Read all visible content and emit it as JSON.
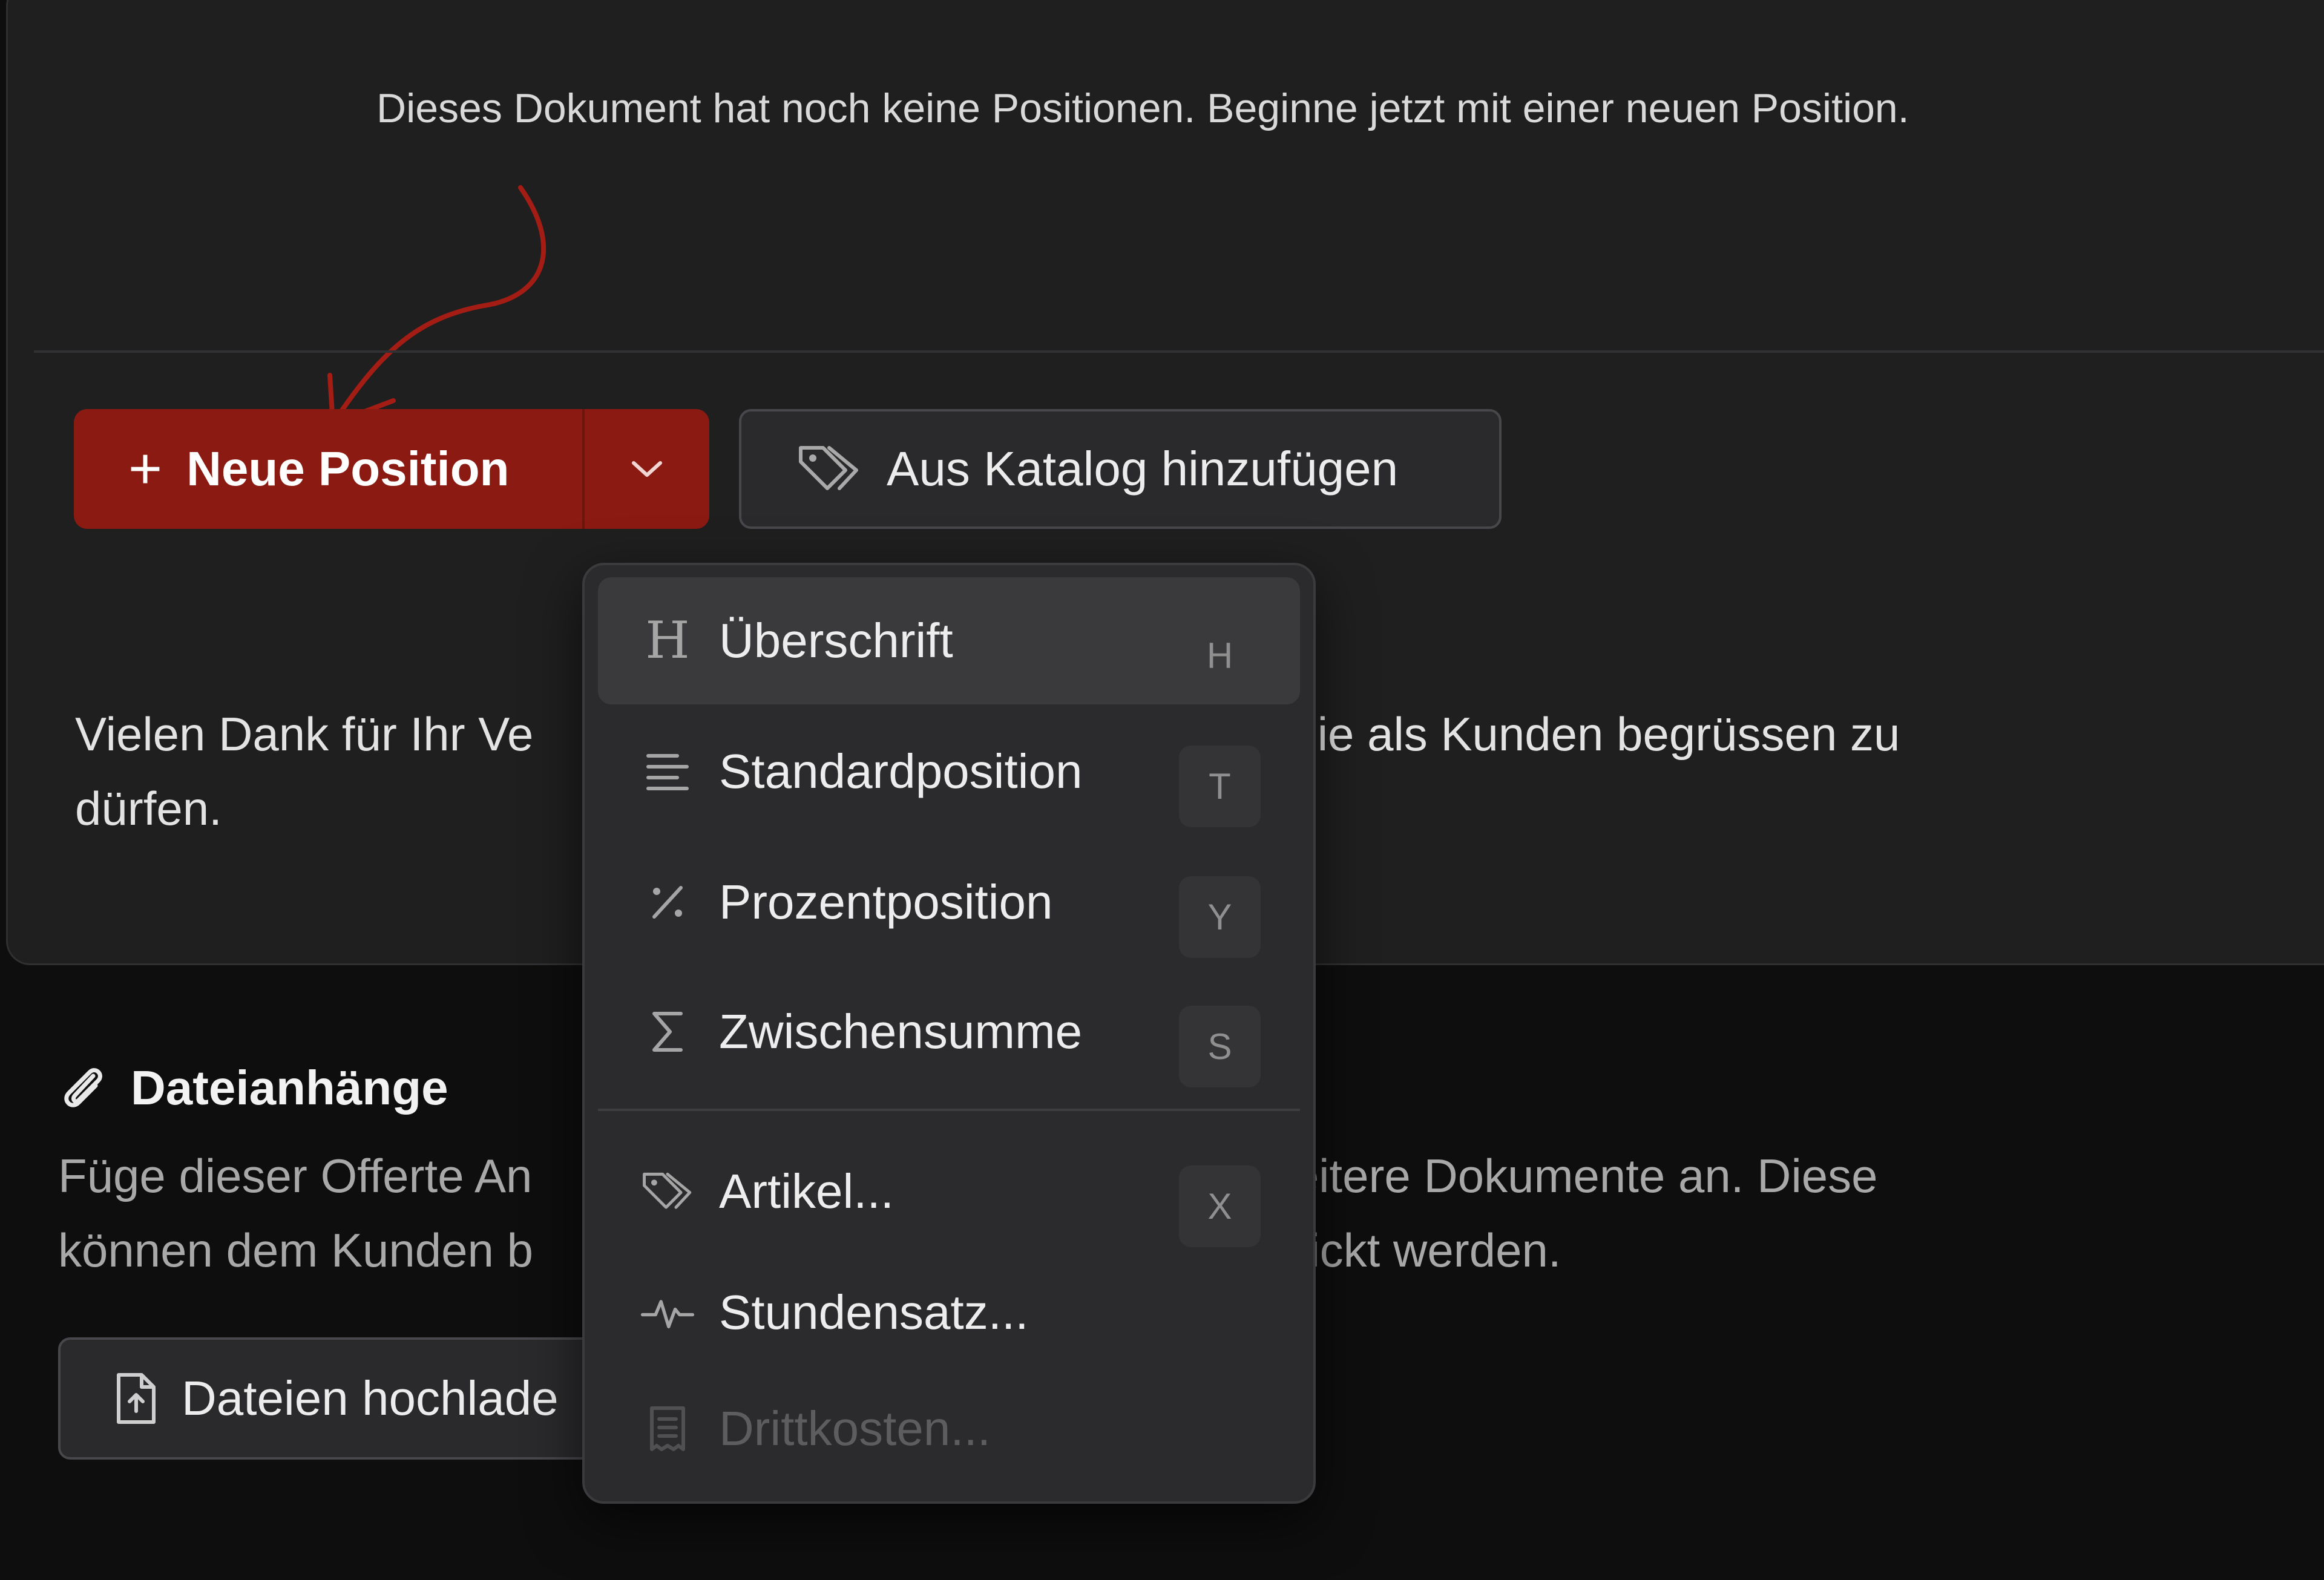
{
  "empty_state": {
    "message": "Dieses Dokument hat noch keine Positionen. Beginne jetzt mit einer neuen Position."
  },
  "toolbar": {
    "new_position_label": "Neue Position",
    "catalog_label": "Aus Katalog hinzufügen"
  },
  "closing_text": "Vielen Dank für Ihr Ve…, Sie als Kunden begrüssen zu dürfen.",
  "closing_text_visible": {
    "line1_left": "Vielen Dank für Ihr Ve",
    "line1_right": ", Sie als Kunden begrüssen zu",
    "line2": "dürfen."
  },
  "attachments": {
    "title": "Dateianhänge",
    "desc_line1_left": "Füge dieser Offerte An",
    "desc_line1_right": "weitere Dokumente an. Diese",
    "desc_line2_left": "können dem Kunden b",
    "desc_line2_right": "chickt werden.",
    "upload_label": "Dateien hochlade"
  },
  "menu": {
    "items": [
      {
        "label": "Überschrift",
        "key": "H",
        "icon": "heading-icon",
        "highlighted": true
      },
      {
        "label": "Standardposition",
        "key": "T",
        "icon": "lines-icon"
      },
      {
        "label": "Prozentposition",
        "key": "Y",
        "icon": "percent-icon"
      },
      {
        "label": "Zwischensumme",
        "key": "S",
        "icon": "sigma-icon"
      },
      {
        "label": "Artikel...",
        "key": "X",
        "icon": "tag-icon"
      },
      {
        "label": "Stundensatz...",
        "key": "",
        "icon": "pulse-icon"
      },
      {
        "label": "Drittkosten...",
        "key": "",
        "icon": "receipt-icon",
        "disabled": true
      }
    ]
  },
  "colors": {
    "primary": "#8b1a12",
    "annotation_arrow": "#a41d14"
  }
}
